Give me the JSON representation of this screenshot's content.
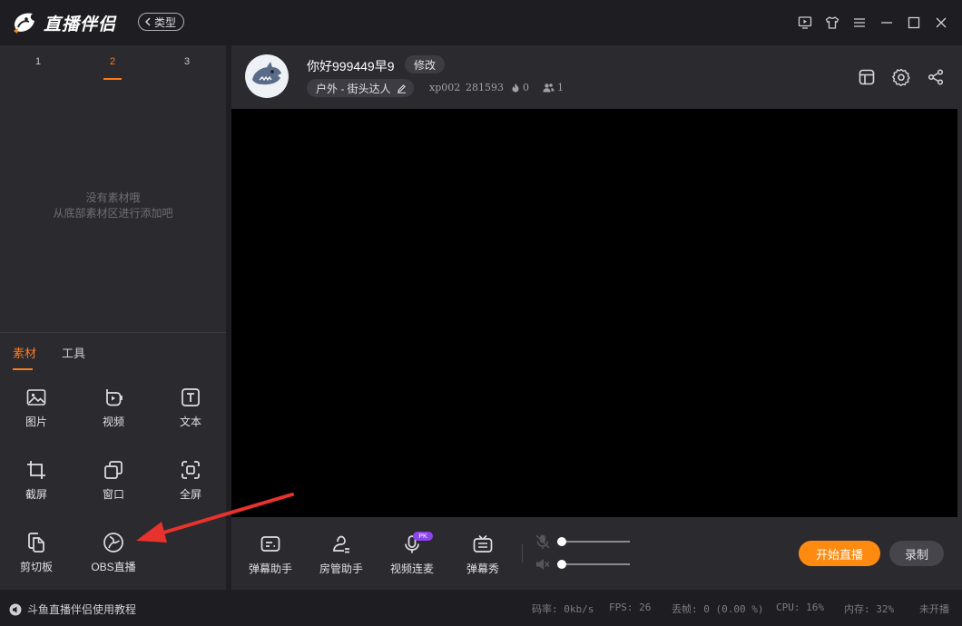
{
  "app": {
    "name": "直播伴侣",
    "type_button": "类型"
  },
  "window_controls": [
    "monitor-play-icon",
    "shirt-icon",
    "menu-icon",
    "minimize-icon",
    "maximize-icon",
    "close-icon"
  ],
  "scenes": {
    "tabs": [
      "1",
      "2",
      "3"
    ],
    "active": "2",
    "empty_line1": "没有素材哦",
    "empty_line2": "从底部素材区进行添加吧"
  },
  "material": {
    "tabs": [
      "素材",
      "工具"
    ],
    "active": "素材",
    "tools": [
      {
        "label": "图片",
        "icon": "image-icon"
      },
      {
        "label": "视频",
        "icon": "video-icon"
      },
      {
        "label": "文本",
        "icon": "text-icon"
      },
      {
        "label": "截屏",
        "icon": "crop-icon"
      },
      {
        "label": "窗口",
        "icon": "window-icon"
      },
      {
        "label": "全屏",
        "icon": "fullscreen-icon"
      },
      {
        "label": "剪切板",
        "icon": "clipboard-icon"
      },
      {
        "label": "OBS直播",
        "icon": "obs-icon"
      }
    ]
  },
  "room": {
    "title": "你好999449早9",
    "edit_label": "修改",
    "category": "户外 - 街头达人",
    "account": "xp002",
    "room_id": "281593",
    "heat": "0",
    "viewers": "1"
  },
  "toolbar": {
    "items": [
      {
        "label": "弹幕助手",
        "icon": "danmu-assistant-icon"
      },
      {
        "label": "房管助手",
        "icon": "room-admin-icon"
      },
      {
        "label": "视频连麦",
        "icon": "mic-icon"
      },
      {
        "label": "弹幕秀",
        "icon": "tv-icon"
      }
    ],
    "pk_badge": "PK",
    "mic_volume": 0,
    "speaker_volume": 0,
    "start_label": "开始直播",
    "record_label": "录制"
  },
  "status": {
    "tutorial": "斗鱼直播伴侣使用教程",
    "bitrate": "码率: 0kb/s",
    "fps": "FPS:  26",
    "dropped": "丢帧: 0 (0.00 %)",
    "cpu": "CPU:  16%",
    "memory": "内存:  32%",
    "live_state": "未开播"
  },
  "colors": {
    "accent": "#ff7a1a",
    "start_button": "#ff8a10",
    "pk_badge": "#8e45f0",
    "annotation_arrow": "#e8322d"
  }
}
